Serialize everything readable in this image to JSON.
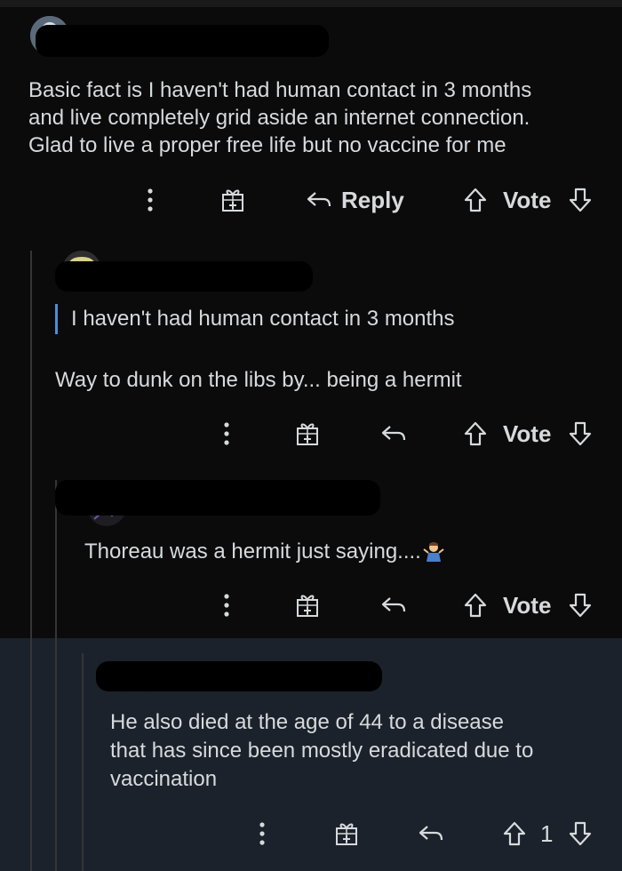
{
  "comments": [
    {
      "text_lines": [
        "Basic fact is I haven't had human contact in 3 months",
        "and live completely grid aside an internet connection.",
        "Glad to live a proper free life but no vaccine for me"
      ],
      "actions": {
        "reply_label": "Reply",
        "vote_label": "Vote"
      }
    },
    {
      "quote": "I haven't had human contact in 3 months",
      "text": "Way to dunk on the libs by... being a hermit",
      "actions": {
        "vote_label": "Vote"
      }
    },
    {
      "text": "Thoreau was a hermit just saying....",
      "actions": {
        "vote_label": "Vote"
      }
    },
    {
      "text_lines": [
        "He also died at the age of 44 to a disease",
        "that has since been mostly eradicated due to",
        "vaccination"
      ],
      "actions": {
        "vote_count": "1"
      }
    }
  ],
  "icons": {
    "more": "more-options-icon",
    "award": "award-gift-icon",
    "reply": "reply-arrow-icon",
    "upvote": "upvote-arrow-icon",
    "downvote": "downvote-arrow-icon"
  },
  "colors": {
    "background": "#0b0b0c",
    "highlight": "#1c222b",
    "quote_bar": "#4a8fd6",
    "text": "#d7dadc"
  }
}
